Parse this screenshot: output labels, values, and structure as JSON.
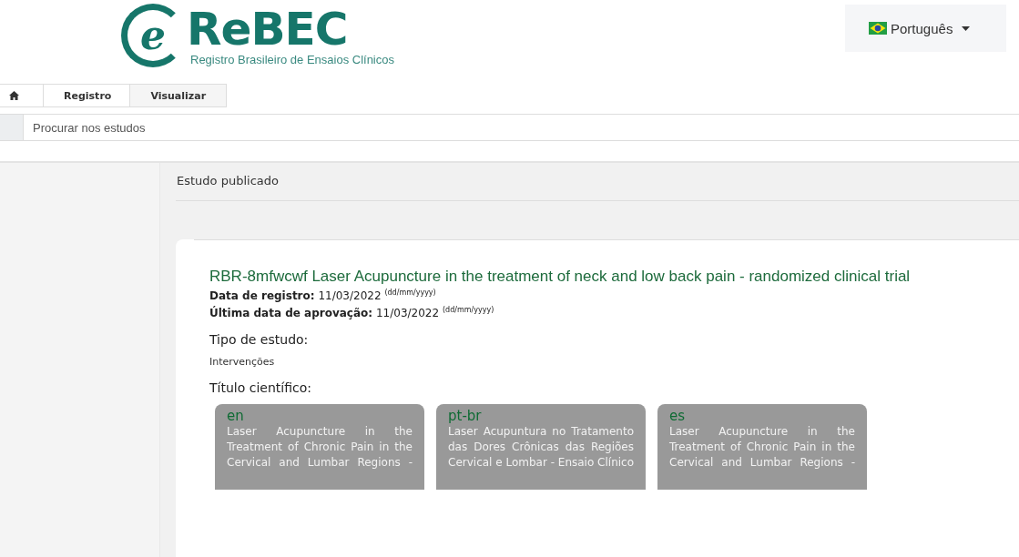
{
  "header": {
    "logo_mark": "e",
    "logo_name": "ReBEC",
    "logo_subtitle": "Registro Brasileiro de Ensaios Clínicos",
    "language": "Português"
  },
  "breadcrumb": [
    "Registro",
    "Visualizar"
  ],
  "search": {
    "placeholder": "Procurar nos estudos"
  },
  "section_title": "Estudo publicado",
  "study": {
    "title": "RBR-8mfwcwf Laser Acupuncture in the treatment of neck and low back pain - randomized clinical trial",
    "dates": [
      {
        "label": "Data de registro:",
        "value": "11/03/2022",
        "format": "(dd/mm/yyyy)"
      },
      {
        "label": "Última data de aprovação:",
        "value": "11/03/2022",
        "format": "(dd/mm/yyyy)"
      }
    ],
    "study_type_heading": "Tipo de estudo:",
    "study_type": "Intervenções",
    "scientific_title_heading": "Título científico:",
    "titles": [
      {
        "lang": "en",
        "lines": [
          "Laser Acupuncture in the",
          "Treatment of Chronic Pain in the",
          "Cervical and Lumbar Regions -"
        ]
      },
      {
        "lang": "pt-br",
        "lines": [
          "Laser Acupuntura no Tratamento",
          "das Dores Crônicas das Regiões",
          "Cervical e Lombar - Ensaio Clínico"
        ]
      },
      {
        "lang": "es",
        "lines": [
          "Laser Acupuncture in the",
          "Treatment of Chronic Pain in the",
          "Cervical and Lumbar Regions -"
        ]
      }
    ]
  }
}
